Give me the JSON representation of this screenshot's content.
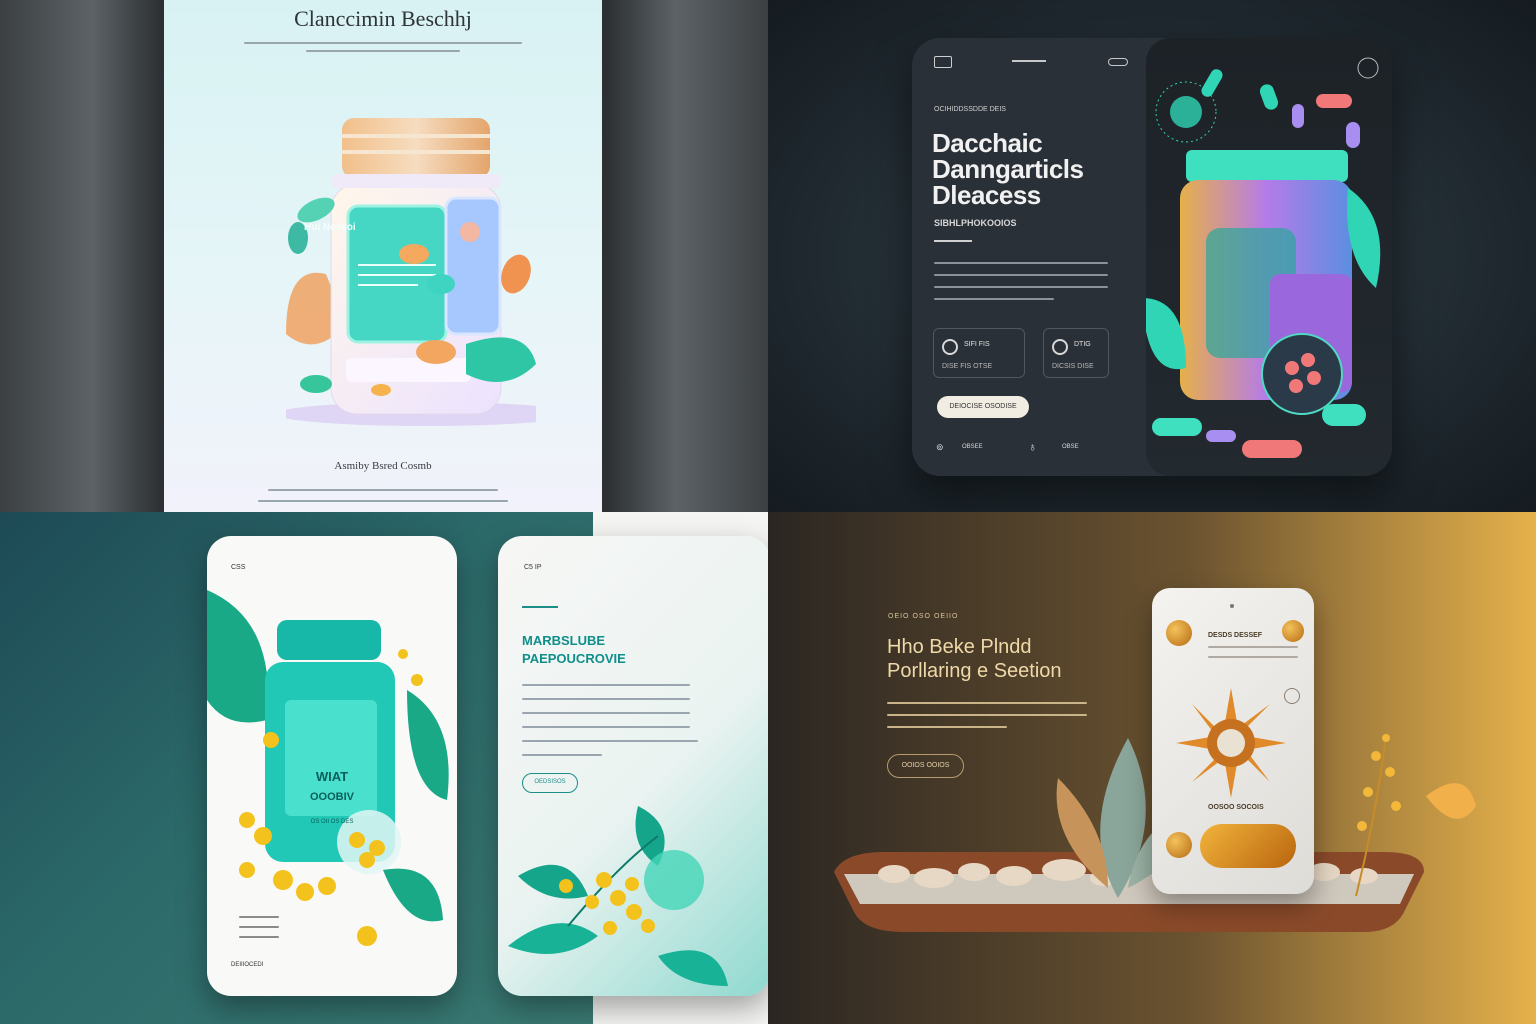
{
  "panel_1": {
    "title": "Clanccimin Beschhj",
    "jar_label": "Hui Nessoi",
    "caption": "Asmiby Bsred Cosmb"
  },
  "panel_2": {
    "small_label": "OCIHIDDSSDDE DEIS",
    "headline": [
      "Dacchaic",
      "Danngarticls",
      "Dleacess"
    ],
    "subheading": "SIBHLPHOKOOIOS",
    "feature_1": {
      "title": "SIFI FIS",
      "subtitle": "DISE FIS OTSE"
    },
    "feature_2": {
      "title": "DTIG",
      "subtitle": "DICSIS DISE"
    },
    "button": "DEIOCISE OSODISE",
    "nav_items": [
      "⊚",
      "OBSEE",
      "♁",
      "OBSE"
    ]
  },
  "panel_3": {
    "left_label": "CSS",
    "jar_text": [
      "WIAT",
      "OOOBIV"
    ],
    "jar_footer": "OS OII OS DES",
    "right_label": "C5 IP",
    "headline": [
      "MARBSLUBE",
      "PAEPOUCROVIE"
    ],
    "button": "OEDSISOS",
    "bottom_label": "DEIIIOCEDI"
  },
  "panel_4": {
    "small_label": "OEIO OSO OEIIO",
    "headline": [
      "Hho Beke Plndd",
      "Porllaring e Seetion"
    ],
    "button": "OOIOS OOIOS",
    "phone_label_1": "DESDS DESSEF",
    "phone_label_2": "OOSOO SOCOIS"
  },
  "colors": {
    "teal": "#19b8a8",
    "mint": "#3fe0c0",
    "amber": "#f3b83a",
    "lavender": "#a88ef0",
    "coral": "#f07878"
  }
}
